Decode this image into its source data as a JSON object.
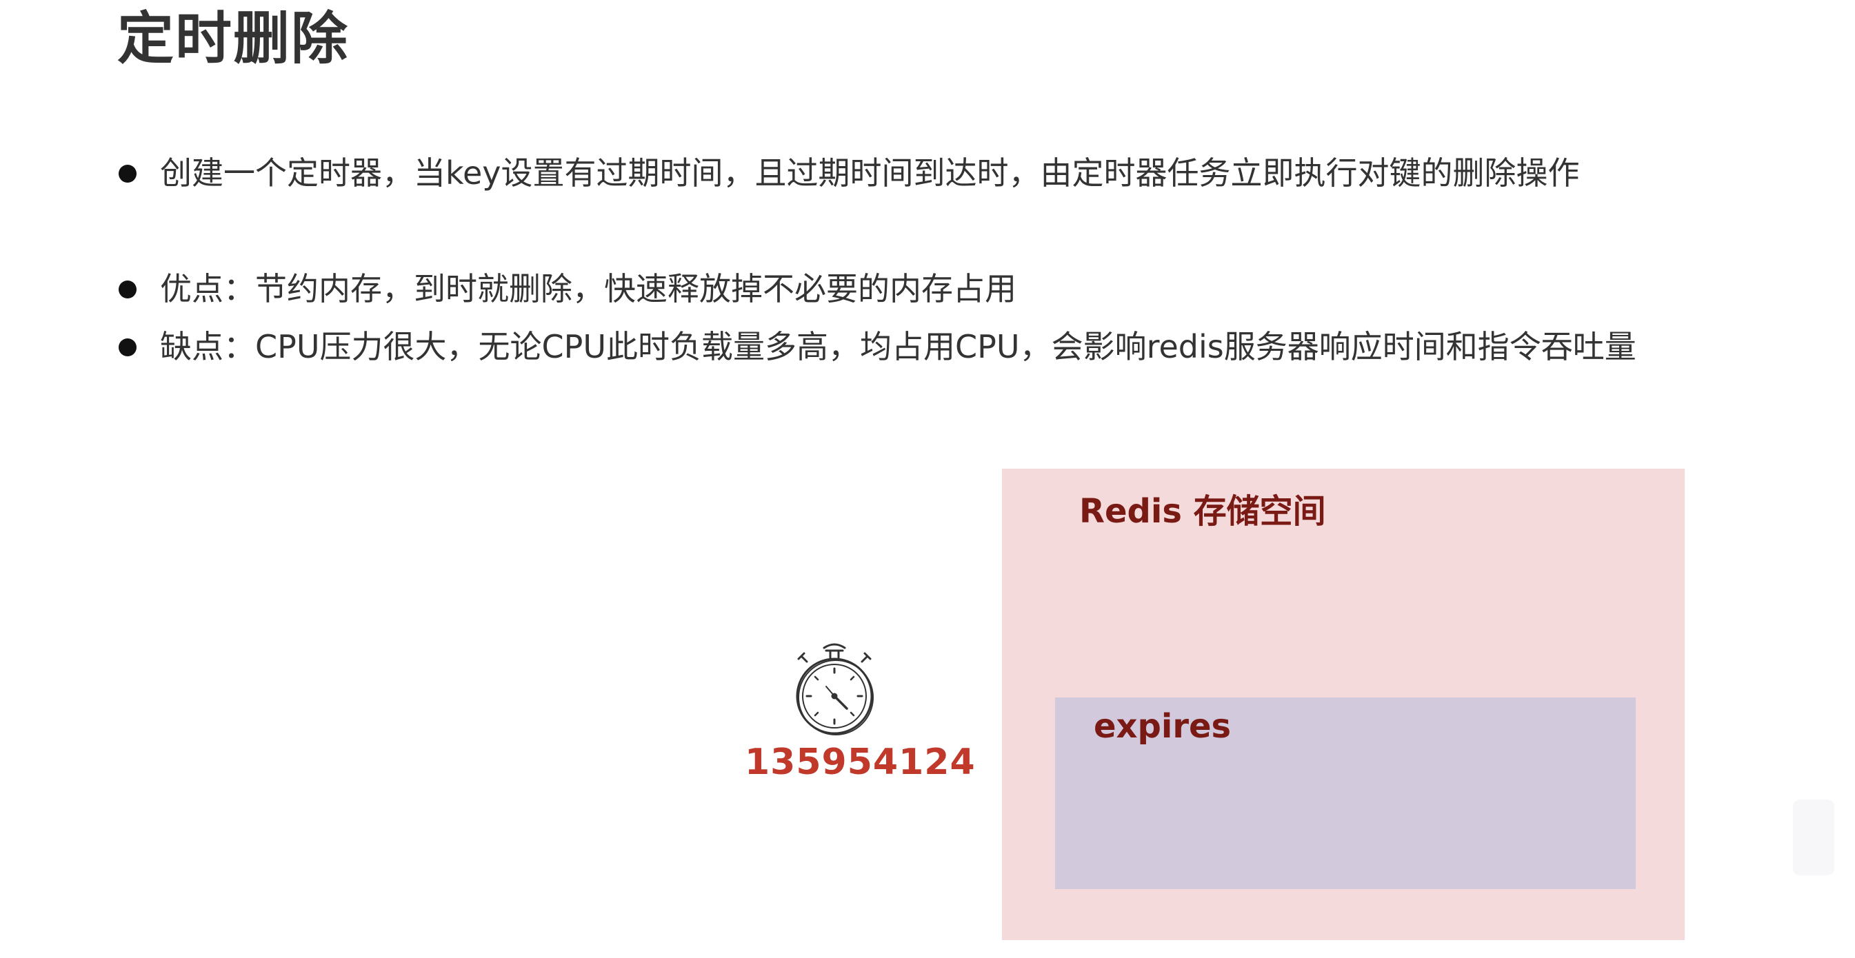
{
  "slide": {
    "title": "定时删除",
    "bullets": [
      "创建一个定时器，当key设置有过期时间，且过期时间到达时，由定时器任务立即执行对键的删除操作",
      "优点：节约内存，到时就删除，快速释放掉不必要的内存占用",
      "缺点：CPU压力很大，无论CPU此时负载量多高，均占用CPU，会影响redis服务器响应时间和指令吞吐量"
    ]
  },
  "diagram": {
    "timer_icon": "stopwatch-icon",
    "timer_value": "135954124",
    "storage_label": "Redis 存储空间",
    "expires_label": "expires",
    "colors": {
      "storage_fill": "#f4dada",
      "expires_fill": "#d3c9dc",
      "label_color": "#7a1a14",
      "timer_value_color": "#c0392b"
    }
  }
}
